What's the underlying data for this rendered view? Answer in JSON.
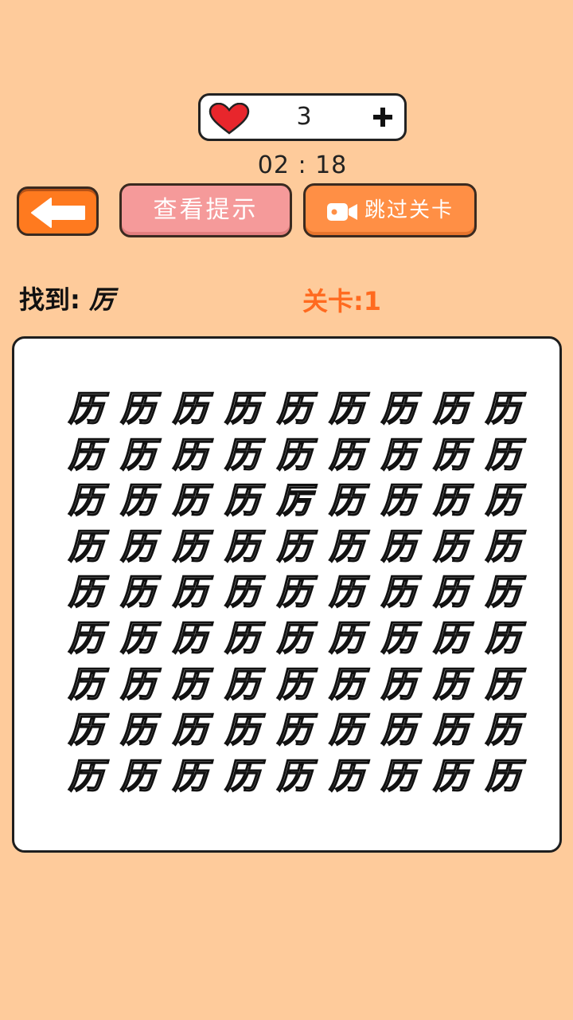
{
  "hud": {
    "lives": "3",
    "timer": "02 : 18"
  },
  "buttons": {
    "hint_label": "查看提示",
    "skip_label": "跳过关卡"
  },
  "task": {
    "find_prefix": "找到: ",
    "target_char": "厉",
    "level_label": "关卡:1"
  },
  "board": {
    "rows": 9,
    "cols": 9,
    "base_char": "历",
    "odd_char": "厉",
    "odd_position": [
      2,
      4
    ]
  },
  "colors": {
    "background": "#fecb9b",
    "heart": "#e8262c",
    "accent_orange": "#ff7a1f",
    "hint_pink": "#f59a9a",
    "level_text": "#ff6a1f"
  },
  "icons": [
    "heart-icon",
    "plus-icon",
    "back-arrow-icon",
    "video-camera-icon"
  ]
}
